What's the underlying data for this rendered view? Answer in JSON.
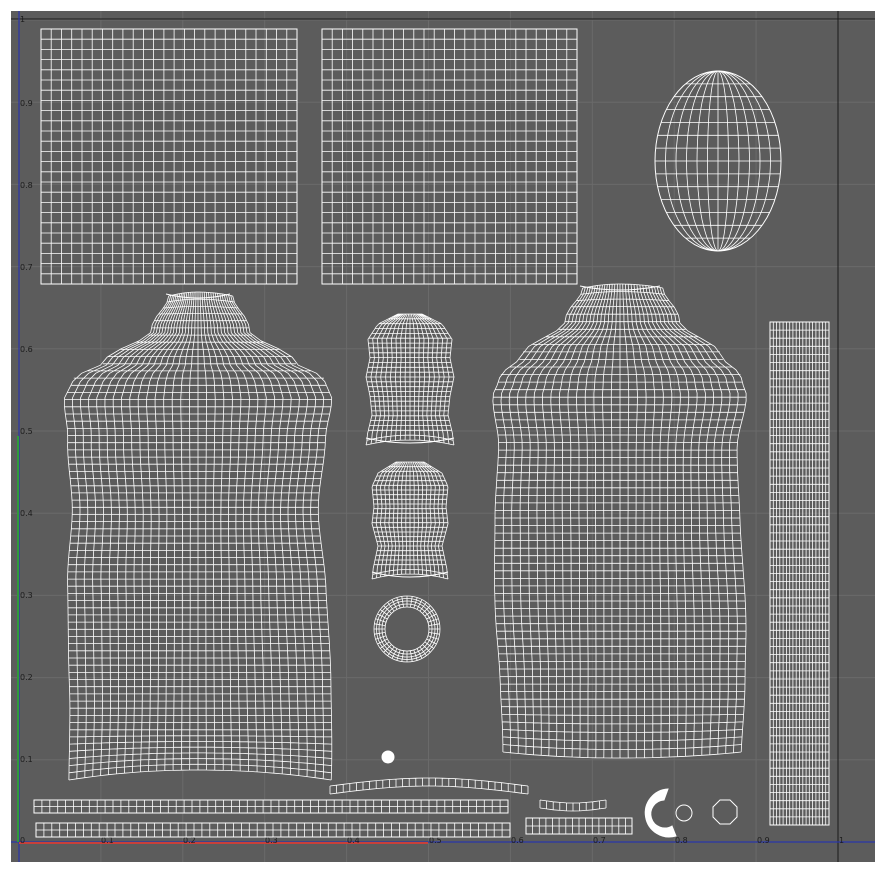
{
  "editor": {
    "viewport_name": "UV editor",
    "x_tick_labels": [
      "0",
      "0.1",
      "0.2",
      "0.3",
      "0.4",
      "0.5",
      "0.6",
      "0.7",
      "0.8",
      "0.9",
      "1"
    ],
    "y_tick_labels": [
      "0.1",
      "0.2",
      "0.3",
      "0.4",
      "0.5",
      "0.6",
      "0.7",
      "0.8",
      "0.9",
      "1"
    ]
  },
  "colors": {
    "background": "#5c5c5c",
    "grid": "#6a6a6a",
    "wireframe": "#ffffff",
    "u_axis": "#c8403a",
    "v_axis": "#2f9a3a",
    "frame_axis": "#2a35a8"
  },
  "uv_shells": [
    "square-grid-left",
    "square-grid-right",
    "head-oval",
    "torso-front",
    "torso-back",
    "sleeve-upper",
    "sleeve-lower",
    "ring-collar",
    "vertical-strip",
    "horizontal-strips",
    "small-pieces"
  ]
}
